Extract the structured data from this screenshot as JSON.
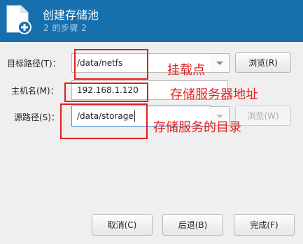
{
  "header": {
    "title": "创建存储池",
    "subtitle": "2 的步骤 2"
  },
  "form": {
    "target_path": {
      "label": "目标路径(T)：",
      "value": "/data/netfs",
      "browse_label": "浏览(R)"
    },
    "host_name": {
      "label": "主机名(M)：",
      "value": "192.168.1.120"
    },
    "source_path": {
      "label": "源路径(S)：",
      "value": "/data/storage",
      "browse_label": "浏览(W)"
    }
  },
  "annotations": {
    "mount_point": "挂载点",
    "storage_server_address": "存储服务器地址",
    "storage_service_directory": "存储服务的目录",
    "color": "#e02020"
  },
  "buttons": {
    "cancel": "取消(C)",
    "back": "后退(B)",
    "finish": "完成(F)"
  },
  "colors": {
    "header_bg": "#1670ad",
    "body_bg": "#efefef"
  }
}
